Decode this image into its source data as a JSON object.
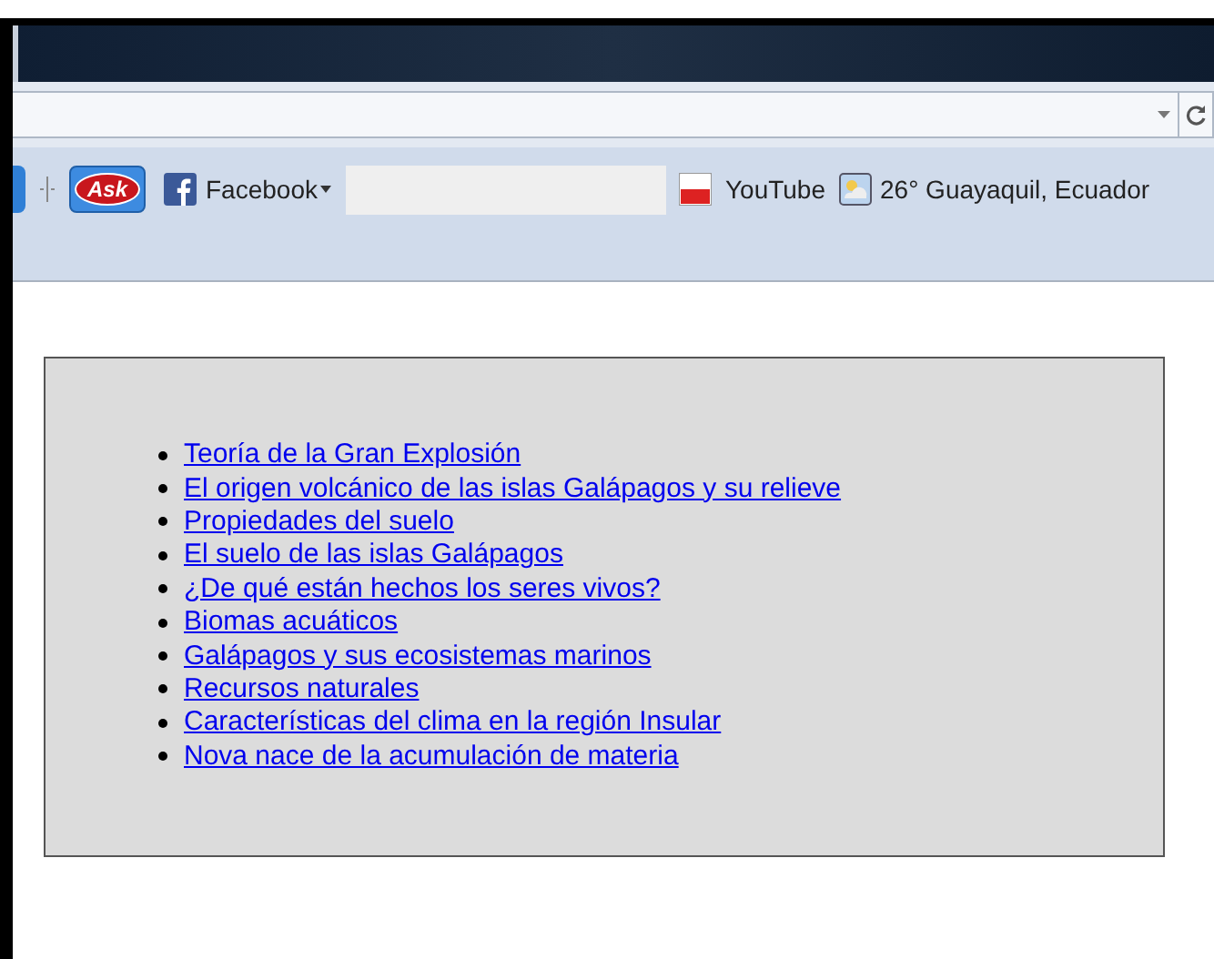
{
  "toolbar": {
    "ask_button": "Ask",
    "facebook": "Facebook",
    "youtube": "YouTube",
    "weather": "26° Guayaquil, Ecuador"
  },
  "links": [
    "Teoría de la Gran Explosión",
    "El origen volcánico de las islas Galápagos y su relieve",
    "Propiedades del suelo",
    "El suelo de las islas Galápagos",
    "¿De qué están hechos los seres vivos?",
    "Biomas acuáticos",
    "Galápagos y sus ecosistemas marinos",
    "Recursos naturales",
    "Características del clima en la región Insular",
    "Nova nace de la acumulación de materia"
  ]
}
